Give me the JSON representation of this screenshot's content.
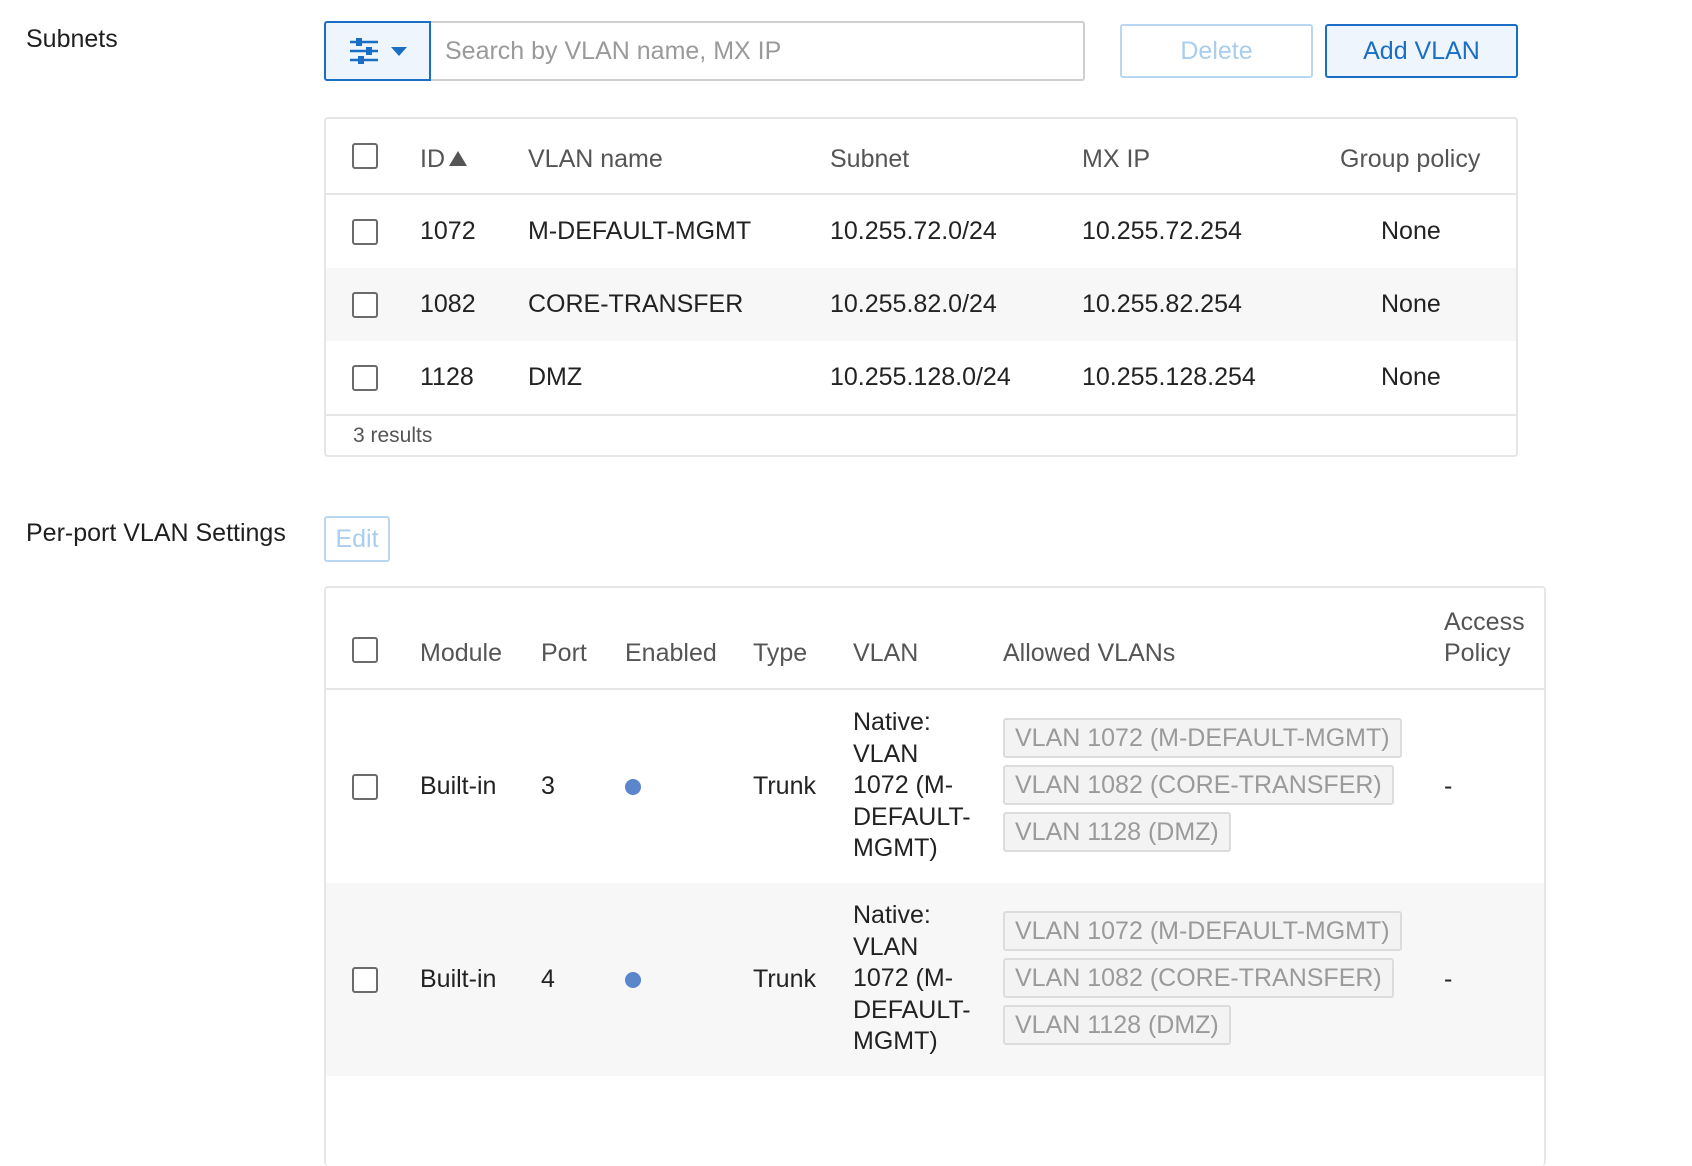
{
  "subnets": {
    "section_label": "Subnets",
    "search_placeholder": "Search by VLAN name, MX IP",
    "delete_label": "Delete",
    "add_label": "Add VLAN",
    "columns": [
      "ID",
      "VLAN name",
      "Subnet",
      "MX IP",
      "Group policy"
    ],
    "rows": [
      {
        "id": "1072",
        "name": "M-DEFAULT-MGMT",
        "subnet": "10.255.72.0/24",
        "mx_ip": "10.255.72.254",
        "group_policy": "None"
      },
      {
        "id": "1082",
        "name": "CORE-TRANSFER",
        "subnet": "10.255.82.0/24",
        "mx_ip": "10.255.82.254",
        "group_policy": "None"
      },
      {
        "id": "1128",
        "name": "DMZ",
        "subnet": "10.255.128.0/24",
        "mx_ip": "10.255.128.254",
        "group_policy": "None"
      }
    ],
    "results_text": "3 results"
  },
  "ports": {
    "section_label": "Per-port VLAN Settings",
    "edit_label": "Edit",
    "columns": [
      "Module",
      "Port",
      "Enabled",
      "Type",
      "VLAN",
      "Allowed VLANs",
      "Access\nPolicy"
    ],
    "rows": [
      {
        "module": "Built-in",
        "port": "3",
        "enabled": true,
        "type": "Trunk",
        "vlan": "Native:\nVLAN\n1072 (M-\nDEFAULT-\nMGMT)",
        "allowed_vlans": [
          "VLAN 1072 (M-DEFAULT-MGMT)",
          "VLAN 1082 (CORE-TRANSFER)",
          "VLAN 1128 (DMZ)"
        ],
        "access_policy": "-"
      },
      {
        "module": "Built-in",
        "port": "4",
        "enabled": true,
        "type": "Trunk",
        "vlan": "Native:\nVLAN\n1072 (M-\nDEFAULT-\nMGMT)",
        "allowed_vlans": [
          "VLAN 1072 (M-DEFAULT-MGMT)",
          "VLAN 1082 (CORE-TRANSFER)",
          "VLAN 1128 (DMZ)"
        ],
        "access_policy": "-"
      }
    ]
  },
  "colors": {
    "accent": "#1a6fc4",
    "accent_light": "#a9cdee",
    "enabled_dot": "#5b86cc",
    "row_alt": "#f7f7f7"
  },
  "icons": {
    "filter": "sliders-icon",
    "dropdown": "caret-down-icon",
    "sort": "sort-ascending-icon",
    "enabled": "status-dot-icon"
  }
}
